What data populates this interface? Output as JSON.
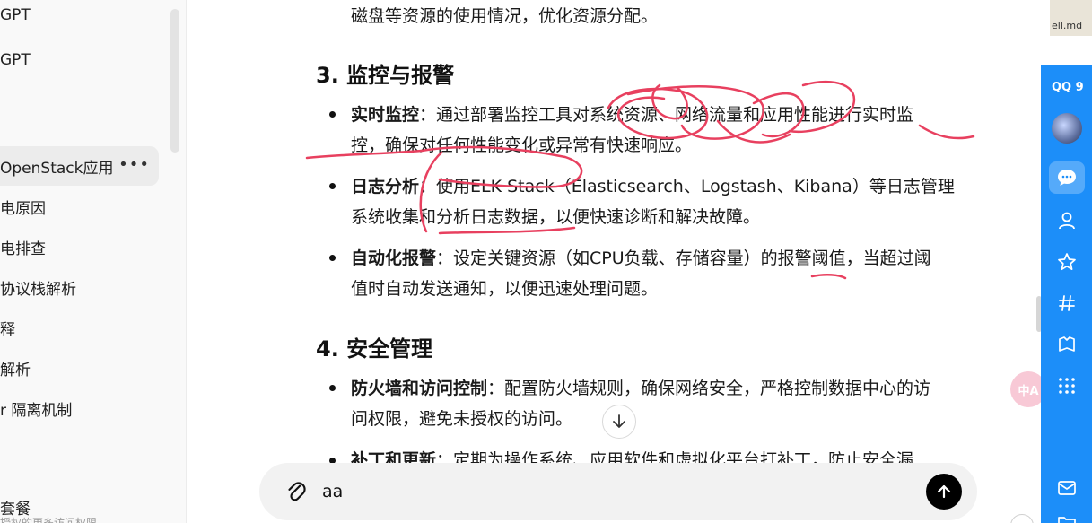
{
  "sidebar": {
    "items": [
      {
        "label": "GPT"
      },
      {
        "label": "GPT"
      },
      {
        "label": "OpenStack应用"
      },
      {
        "label": "电原因"
      },
      {
        "label": "电排查"
      },
      {
        "label": "协议栈解析"
      },
      {
        "label": "释"
      },
      {
        "label": "解析"
      },
      {
        "label": "r 隔离机制"
      }
    ],
    "active_more": "•••",
    "bottom_label": "套餐",
    "bottom_sub": "授权的更多访问权限"
  },
  "article": {
    "top_line": "磁盘等资源的使用情况，优化资源分配。",
    "section3": {
      "heading": "3. 监控与报警",
      "items": [
        {
          "title": "实时监控",
          "line1": "：通过部署监控工具对系统资源、网络流量和应用性能进行实时监",
          "line2": "控，确保对任何性能变化或异常有快速响应。"
        },
        {
          "title": "日志分析",
          "line1": "：使用ELK Stack（Elasticsearch、Logstash、Kibana）等日志管理",
          "line2": "系统收集和分析日志数据，以便快速诊断和解决故障。"
        },
        {
          "title": "自动化报警",
          "line1": "：设定关键资源（如CPU负载、存储容量）的报警阈值，当超过阈",
          "line2": "值时自动发送通知，以便迅速处理问题。"
        }
      ]
    },
    "section4": {
      "heading": "4. 安全管理",
      "items": [
        {
          "title": "防火墙和访问控制",
          "line1": "：配置防火墙规则，确保网络安全，严格控制数据中心的访",
          "line2": "问权限，避免未授权的访问。"
        },
        {
          "title": "补丁和更新",
          "line1": "：定期为操作系统、应用软件和虚拟化平台打补丁，防止安全漏"
        }
      ]
    }
  },
  "composer": {
    "value": "aa",
    "attach_icon": "paperclip-icon",
    "send_icon": "arrow-up-icon"
  },
  "scroll_down_icon": "arrow-down-icon",
  "pink_fab_text": "中A",
  "qq": {
    "title": "QQ 9",
    "accent": "#1c8ef9"
  },
  "thumb_label": "ell.md",
  "ink_color": "#e8405f"
}
